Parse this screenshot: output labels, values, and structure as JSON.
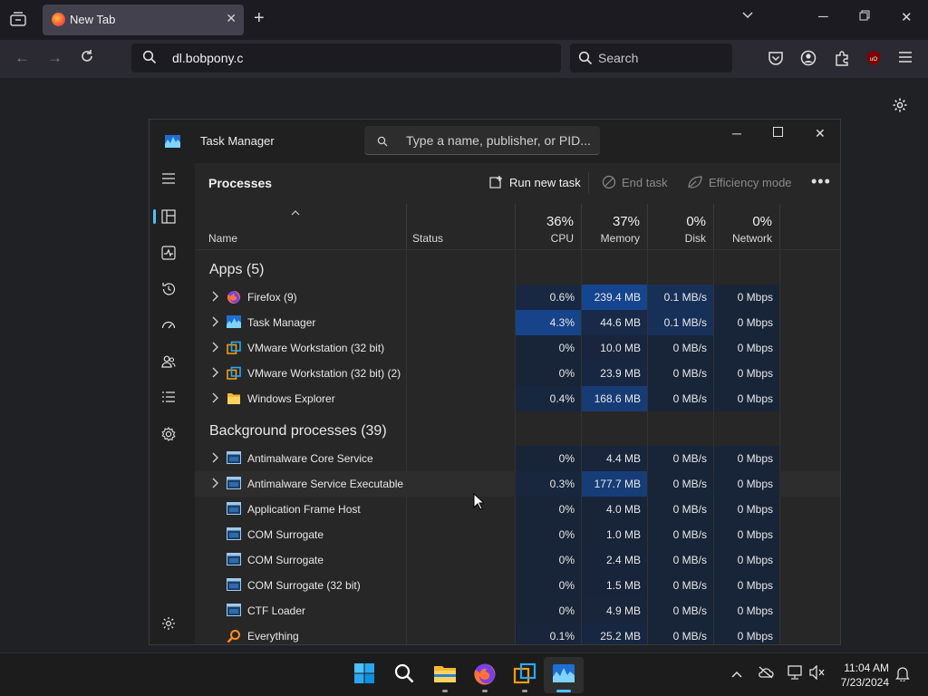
{
  "browser": {
    "tab_title": "New Tab",
    "url": "dl.bobpony.c",
    "search_placeholder": "Search",
    "colors": {
      "tab_bg": "#42414d",
      "toolbar_bg": "#2b2a33",
      "url_bg": "#1c1b22"
    }
  },
  "task_manager": {
    "title": "Task Manager",
    "search_placeholder": "Type a name, publisher, or PID...",
    "page_title": "Processes",
    "actions": {
      "run_new_task": "Run new task",
      "end_task": "End task",
      "efficiency_mode": "Efficiency mode"
    },
    "columns": {
      "name": "Name",
      "status": "Status",
      "cpu": {
        "pct": "36%",
        "label": "CPU"
      },
      "memory": {
        "pct": "37%",
        "label": "Memory"
      },
      "disk": {
        "pct": "0%",
        "label": "Disk"
      },
      "network": {
        "pct": "0%",
        "label": "Network"
      }
    },
    "groups": {
      "apps": "Apps (5)",
      "background": "Background processes (39)"
    },
    "apps": [
      {
        "name": "Firefox (9)",
        "icon": "firefox-icon",
        "cpu": "0.6%",
        "memory": "239.4 MB",
        "disk": "0.1 MB/s",
        "network": "0 Mbps",
        "expandable": true
      },
      {
        "name": "Task Manager",
        "icon": "task-manager-icon",
        "cpu": "4.3%",
        "memory": "44.6 MB",
        "disk": "0.1 MB/s",
        "network": "0 Mbps",
        "expandable": true
      },
      {
        "name": "VMware Workstation (32 bit)",
        "icon": "vmware-icon",
        "cpu": "0%",
        "memory": "10.0 MB",
        "disk": "0 MB/s",
        "network": "0 Mbps",
        "expandable": true
      },
      {
        "name": "VMware Workstation (32 bit) (2)",
        "icon": "vmware-icon",
        "cpu": "0%",
        "memory": "23.9 MB",
        "disk": "0 MB/s",
        "network": "0 Mbps",
        "expandable": true
      },
      {
        "name": "Windows Explorer",
        "icon": "folder-icon",
        "cpu": "0.4%",
        "memory": "168.6 MB",
        "disk": "0 MB/s",
        "network": "0 Mbps",
        "expandable": true
      }
    ],
    "background": [
      {
        "name": "Antimalware Core Service",
        "icon": "service-icon",
        "cpu": "0%",
        "memory": "4.4 MB",
        "disk": "0 MB/s",
        "network": "0 Mbps",
        "expandable": true
      },
      {
        "name": "Antimalware Service Executable",
        "icon": "service-icon",
        "cpu": "0.3%",
        "memory": "177.7 MB",
        "disk": "0 MB/s",
        "network": "0 Mbps",
        "expandable": true
      },
      {
        "name": "Application Frame Host",
        "icon": "service-icon",
        "cpu": "0%",
        "memory": "4.0 MB",
        "disk": "0 MB/s",
        "network": "0 Mbps",
        "expandable": false
      },
      {
        "name": "COM Surrogate",
        "icon": "service-icon",
        "cpu": "0%",
        "memory": "1.0 MB",
        "disk": "0 MB/s",
        "network": "0 Mbps",
        "expandable": false
      },
      {
        "name": "COM Surrogate",
        "icon": "service-icon",
        "cpu": "0%",
        "memory": "2.4 MB",
        "disk": "0 MB/s",
        "network": "0 Mbps",
        "expandable": false
      },
      {
        "name": "COM Surrogate (32 bit)",
        "icon": "service-icon",
        "cpu": "0%",
        "memory": "1.5 MB",
        "disk": "0 MB/s",
        "network": "0 Mbps",
        "expandable": false
      },
      {
        "name": "CTF Loader",
        "icon": "service-icon",
        "cpu": "0%",
        "memory": "4.9 MB",
        "disk": "0 MB/s",
        "network": "0 Mbps",
        "expandable": false
      },
      {
        "name": "Everything",
        "icon": "search-orange-icon",
        "cpu": "0.1%",
        "memory": "25.2 MB",
        "disk": "0 MB/s",
        "network": "0 Mbps",
        "expandable": false
      }
    ]
  },
  "taskbar": {
    "time": "11:04 AM",
    "date": "7/23/2024"
  }
}
